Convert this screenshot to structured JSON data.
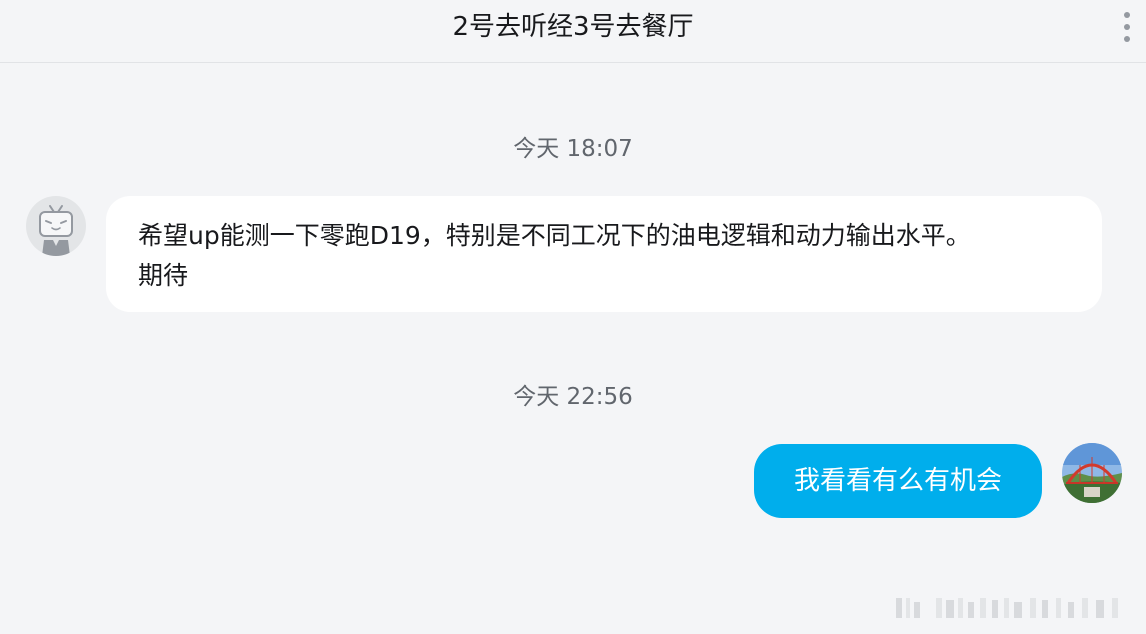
{
  "header": {
    "title": "2号去听经3号去餐厅",
    "more_icon": "more-vertical-icon"
  },
  "messages": [
    {
      "time": "今天 18:07",
      "sender": "other",
      "avatar_icon": "tv-mascot-avatar",
      "text_line1": "希望up能测一下零跑D19，特别是不同工况下的油电逻辑和动力输出水平。",
      "text_line2": "期待"
    },
    {
      "time": "今天 22:56",
      "sender": "self",
      "avatar_icon": "bridge-photo-avatar",
      "text": "我看看有么有机会"
    }
  ],
  "colors": {
    "background": "#f4f5f7",
    "self_bubble": "#00aeec",
    "other_bubble": "#ffffff",
    "timestamp_text": "#61666d"
  }
}
